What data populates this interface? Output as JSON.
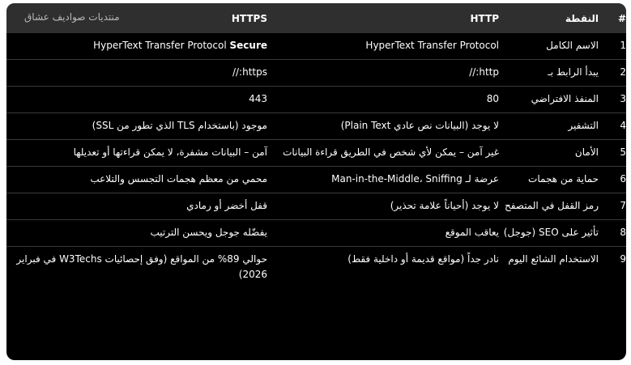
{
  "site_name": "منتديات صواديف عشاق",
  "table": {
    "headers": {
      "num": "#",
      "point": "النقطة",
      "http": "HTTP",
      "https": "HTTPS"
    },
    "rows": [
      {
        "num": "1",
        "point": "الاسم الكامل",
        "http": "HyperText Transfer Protocol",
        "https_a": "HyperText Transfer Protocol ",
        "https_b": "Secure"
      },
      {
        "num": "2",
        "point": "يبدأ الرابط بـ",
        "http": "http://",
        "https": "https://"
      },
      {
        "num": "3",
        "point": "المنفذ الافتراضي",
        "http": "80",
        "https": "443"
      },
      {
        "num": "4",
        "point": "التشفير",
        "http": "لا يوجد (البيانات نص عادي Plain Text)",
        "https": "موجود (باستخدام TLS الذي تطور من SSL)"
      },
      {
        "num": "5",
        "point": "الأمان",
        "http": "غير آمن – يمكن لأي شخص في الطريق قراءة البيانات",
        "https": "آمن – البيانات مشفرة، لا يمكن قراءتها أو تعديلها"
      },
      {
        "num": "6",
        "point": "حماية من هجمات",
        "http": "عرضة لـ Man-in-the-Middle، Sniffing",
        "https": "محمي من معظم هجمات التجسس والتلاعب"
      },
      {
        "num": "7",
        "point": "رمز القفل في المتصفح",
        "http": "لا يوجد (أحياناً علامة تحذير)",
        "https": "قفل أخضر أو رمادي"
      },
      {
        "num": "8",
        "point": "تأثير على SEO (جوجل)",
        "http": "يعاقب الموقع",
        "https": "يفضّله جوجل ويحسن الترتيب"
      },
      {
        "num": "9",
        "point": "الاستخدام الشائع اليوم",
        "http": "نادر جداً (مواقع قديمة أو داخلية فقط)",
        "https": "حوالي 89% من المواقع (وفق إحصائيات W3Techs في فبراير 2026)"
      }
    ]
  }
}
